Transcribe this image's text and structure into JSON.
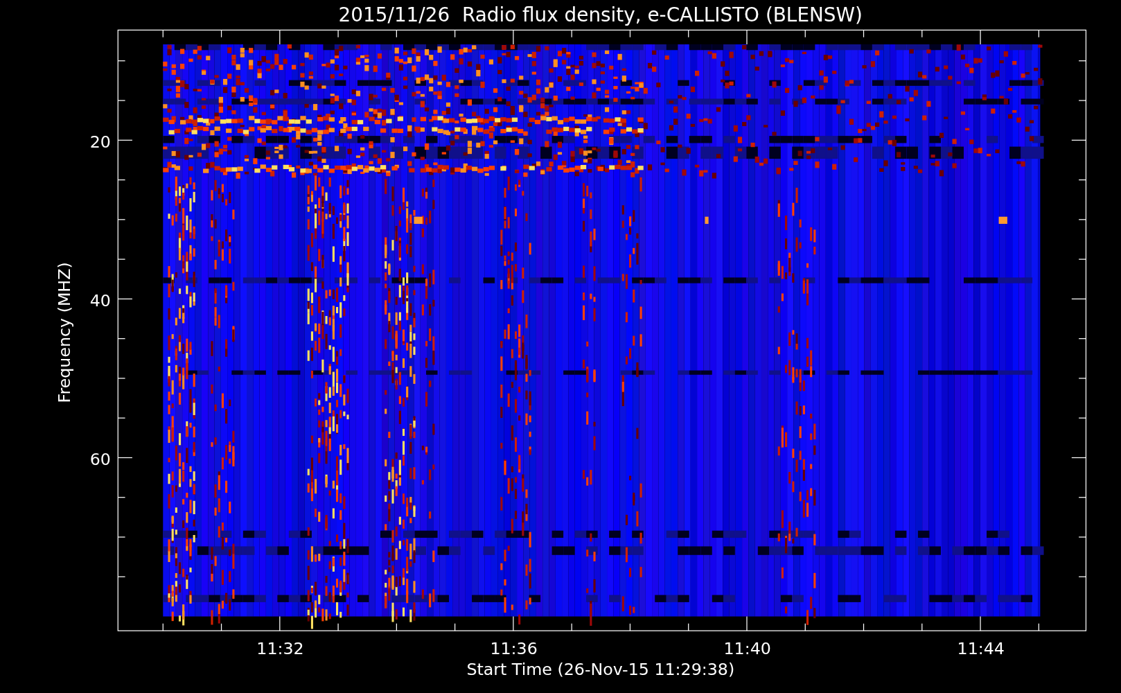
{
  "title": "2015/11/26  Radio flux density, e-CALLISTO (BLENSW)",
  "xlabel": "Start Time (26-Nov-15 11:29:38)",
  "ylabel": "Frequency (MHZ)",
  "xticks": [
    "11:32",
    "11:36",
    "11:40",
    "11:44"
  ],
  "yticks": [
    "20",
    "40",
    "60"
  ]
}
